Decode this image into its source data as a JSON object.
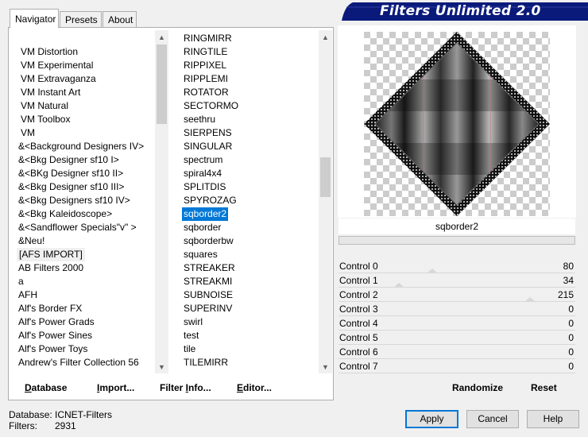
{
  "app_title": "Filters Unlimited 2.0",
  "tabs": [
    "Navigator",
    "Presets",
    "About"
  ],
  "categories": [
    "VM Distortion",
    "VM Experimental",
    "VM Extravaganza",
    "VM Instant Art",
    "VM Natural",
    "VM Toolbox",
    "VM",
    "&<Background Designers IV>",
    "&<Bkg Designer sf10 I>",
    "&<BKg Designer sf10 II>",
    "&<Bkg Designer sf10 III>",
    "&<Bkg Designers sf10 IV>",
    "&<Bkg Kaleidoscope>",
    "&<Sandflower Specials\"v\" >",
    "&Neu!",
    "[AFS IMPORT]",
    "AB Filters 2000",
    "a",
    "AFH",
    "Alf's Border FX",
    "Alf's Power Grads",
    "Alf's Power Sines",
    "Alf's Power Toys",
    "Andrew's Filter Collection 56"
  ],
  "categories_focused": "[AFS IMPORT]",
  "filters": [
    "RINGMIRR",
    "RINGTILE",
    "RIPPIXEL",
    "RIPPLEMI",
    "ROTATOR",
    "SECTORMO",
    "seethru",
    "SIERPENS",
    "SINGULAR",
    "spectrum",
    "spiral4x4",
    "SPLITDIS",
    "SPYROZAG",
    "sqborder2",
    "sqborder",
    "sqborderbw",
    "squares",
    "STREAKER",
    "STREAKMI",
    "SUBNOISE",
    "SUPERINV",
    "swirl",
    "test",
    "tile",
    "TILEMIRR"
  ],
  "filters_selected": "sqborder2",
  "filter_name": "sqborder2",
  "controls": [
    {
      "label": "Control 0",
      "value": "80",
      "level": 0.314
    },
    {
      "label": "Control 1",
      "value": "34",
      "level": 0.133
    },
    {
      "label": "Control 2",
      "value": "215",
      "level": 0.843
    },
    {
      "label": "Control 3",
      "value": "0",
      "level": 0
    },
    {
      "label": "Control 4",
      "value": "0",
      "level": 0
    },
    {
      "label": "Control 5",
      "value": "0",
      "level": 0
    },
    {
      "label": "Control 6",
      "value": "0",
      "level": 0
    },
    {
      "label": "Control 7",
      "value": "0",
      "level": 0
    }
  ],
  "toolbar": {
    "database": {
      "ul": "D",
      "rest": "atabase"
    },
    "import": {
      "ul": "I",
      "rest": "mport..."
    },
    "filter_info": {
      "pre": "Filter ",
      "ul": "I",
      "rest": "nfo..."
    },
    "editor": {
      "ul": "E",
      "rest": "ditor..."
    },
    "randomize": "Randomize",
    "reset": "Reset"
  },
  "buttons": {
    "apply": "Apply",
    "cancel": "Cancel",
    "help": "Help"
  },
  "status": {
    "database_label": "Database:",
    "database_value": "ICNET-Filters",
    "filters_label": "Filters:",
    "filters_value": "2931"
  },
  "colors": {
    "accent": "#0078d7",
    "banner": "#0a1a7a"
  }
}
